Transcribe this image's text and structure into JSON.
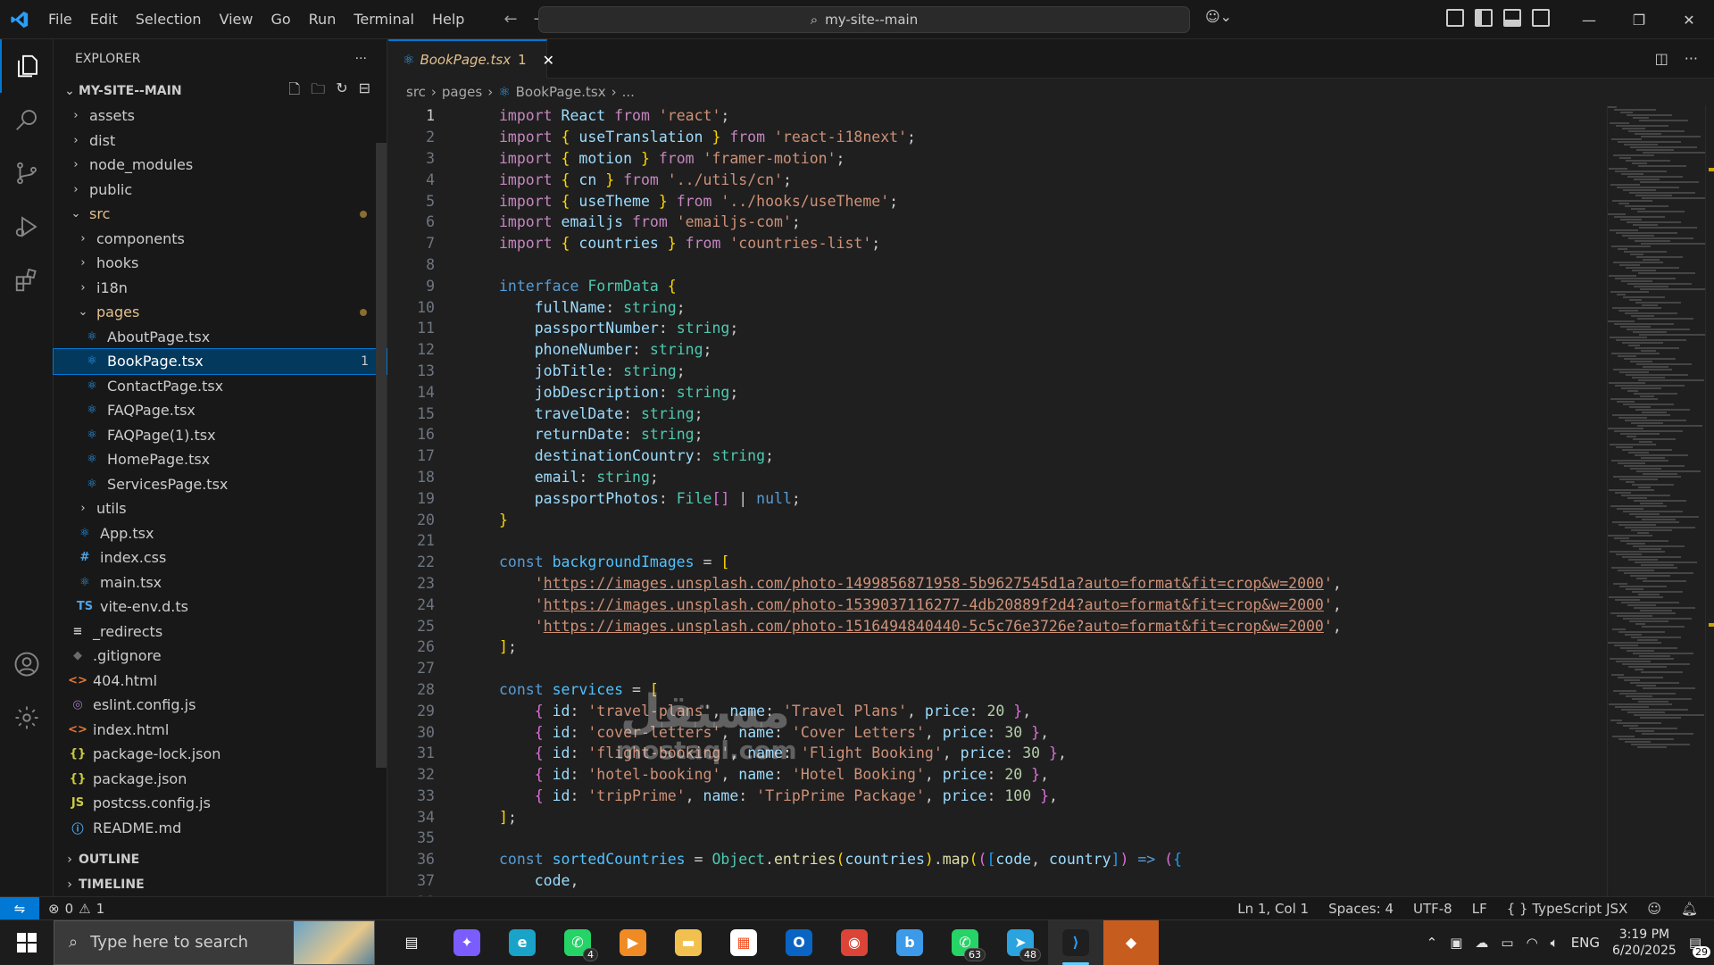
{
  "titlebar": {
    "menu": [
      "File",
      "Edit",
      "Selection",
      "View",
      "Go",
      "Run",
      "Terminal",
      "Help"
    ],
    "search_text": "my-site--main",
    "icons": [
      "vscode-logo-icon",
      "back-arrow-icon",
      "forward-arrow-icon",
      "copilot-icon",
      "toggle-panel-icon",
      "minimize-icon",
      "maximize-icon",
      "close-icon"
    ]
  },
  "sidebar": {
    "title": "EXPLORER",
    "root": "MY-SITE--MAIN",
    "tree": [
      {
        "name": "assets",
        "kind": "folder",
        "depth": 1,
        "open": false
      },
      {
        "name": "dist",
        "kind": "folder",
        "depth": 1,
        "open": false
      },
      {
        "name": "node_modules",
        "kind": "folder",
        "depth": 1,
        "open": false
      },
      {
        "name": "public",
        "kind": "folder",
        "depth": 1,
        "open": false
      },
      {
        "name": "src",
        "kind": "folder",
        "depth": 1,
        "open": true,
        "modified": true
      },
      {
        "name": "components",
        "kind": "folder",
        "depth": 2,
        "open": false
      },
      {
        "name": "hooks",
        "kind": "folder",
        "depth": 2,
        "open": false
      },
      {
        "name": "i18n",
        "kind": "folder",
        "depth": 2,
        "open": false
      },
      {
        "name": "pages",
        "kind": "folder",
        "depth": 2,
        "open": true,
        "modified": true
      },
      {
        "name": "AboutPage.tsx",
        "kind": "react",
        "depth": 3
      },
      {
        "name": "BookPage.tsx",
        "kind": "react",
        "depth": 3,
        "selected": true,
        "badge": "1"
      },
      {
        "name": "ContactPage.tsx",
        "kind": "react",
        "depth": 3
      },
      {
        "name": "FAQPage.tsx",
        "kind": "react",
        "depth": 3
      },
      {
        "name": "FAQPage(1).tsx",
        "kind": "react",
        "depth": 3
      },
      {
        "name": "HomePage.tsx",
        "kind": "react",
        "depth": 3
      },
      {
        "name": "ServicesPage.tsx",
        "kind": "react",
        "depth": 3
      },
      {
        "name": "utils",
        "kind": "folder",
        "depth": 2,
        "open": false
      },
      {
        "name": "App.tsx",
        "kind": "react",
        "depth": 2
      },
      {
        "name": "index.css",
        "kind": "css",
        "depth": 2
      },
      {
        "name": "main.tsx",
        "kind": "react",
        "depth": 2
      },
      {
        "name": "vite-env.d.ts",
        "kind": "ts",
        "depth": 2
      },
      {
        "name": "_redirects",
        "kind": "text",
        "depth": 1
      },
      {
        "name": ".gitignore",
        "kind": "git",
        "depth": 1
      },
      {
        "name": "404.html",
        "kind": "html",
        "depth": 1
      },
      {
        "name": "eslint.config.js",
        "kind": "eslint",
        "depth": 1
      },
      {
        "name": "index.html",
        "kind": "html",
        "depth": 1
      },
      {
        "name": "package-lock.json",
        "kind": "json",
        "depth": 1
      },
      {
        "name": "package.json",
        "kind": "json",
        "depth": 1
      },
      {
        "name": "postcss.config.js",
        "kind": "js",
        "depth": 1
      },
      {
        "name": "README.md",
        "kind": "info",
        "depth": 1
      }
    ],
    "outline_label": "OUTLINE",
    "timeline_label": "TIMELINE"
  },
  "editor": {
    "tab_label": "BookPage.tsx",
    "tab_problems": "1",
    "breadcrumb": [
      "src",
      "pages",
      "BookPage.tsx",
      "..."
    ],
    "current_line": 1
  },
  "statusbar": {
    "errors": "0",
    "warnings": "1",
    "position": "Ln 1, Col 1",
    "spaces": "Spaces: 4",
    "encoding": "UTF-8",
    "eol": "LF",
    "language": "TypeScript JSX"
  },
  "taskbar": {
    "search_placeholder": "Type here to search",
    "apps": [
      {
        "name": "task-view",
        "icon": "task-view-icon"
      },
      {
        "name": "copilot",
        "icon": "copilot-icon"
      },
      {
        "name": "edge",
        "icon": "edge-icon"
      },
      {
        "name": "whatsapp",
        "icon": "whatsapp-icon",
        "count": "4"
      },
      {
        "name": "media-player",
        "icon": "media-player-icon"
      },
      {
        "name": "file-explorer",
        "icon": "folder-icon"
      },
      {
        "name": "store",
        "icon": "store-icon"
      },
      {
        "name": "outlook",
        "icon": "outlook-icon"
      },
      {
        "name": "chrome",
        "icon": "chrome-icon"
      },
      {
        "name": "bluesky",
        "icon": "bluesky-icon"
      },
      {
        "name": "whatsapp-2",
        "icon": "whatsapp-icon",
        "count": "63"
      },
      {
        "name": "telegram",
        "icon": "telegram-icon",
        "count": "48"
      },
      {
        "name": "vscode",
        "icon": "vscode-icon",
        "active": true
      },
      {
        "name": "git",
        "icon": "git-icon"
      }
    ],
    "lang": "ENG",
    "time": "3:19 PM",
    "date": "6/20/2025",
    "notifications": "29"
  },
  "watermark": {
    "line1": "مستقل",
    "line2": "mostaql.com"
  },
  "colors": {
    "accent": "#0078d4",
    "selection": "#04395e",
    "modified": "#e2c08d"
  }
}
